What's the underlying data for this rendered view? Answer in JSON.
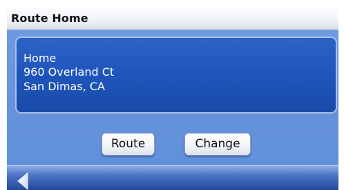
{
  "title_bar": {
    "title": "Route Home"
  },
  "address": {
    "name": "Home",
    "street": "960 Overland Ct",
    "city_state": "San Dimas, CA"
  },
  "actions": {
    "route_label": "Route",
    "change_label": "Change"
  },
  "nav": {
    "back_icon": "back-arrow-icon"
  },
  "colors": {
    "background": "#6e9be0",
    "panel": "#2459be",
    "title_bar": "#eef1f7"
  }
}
